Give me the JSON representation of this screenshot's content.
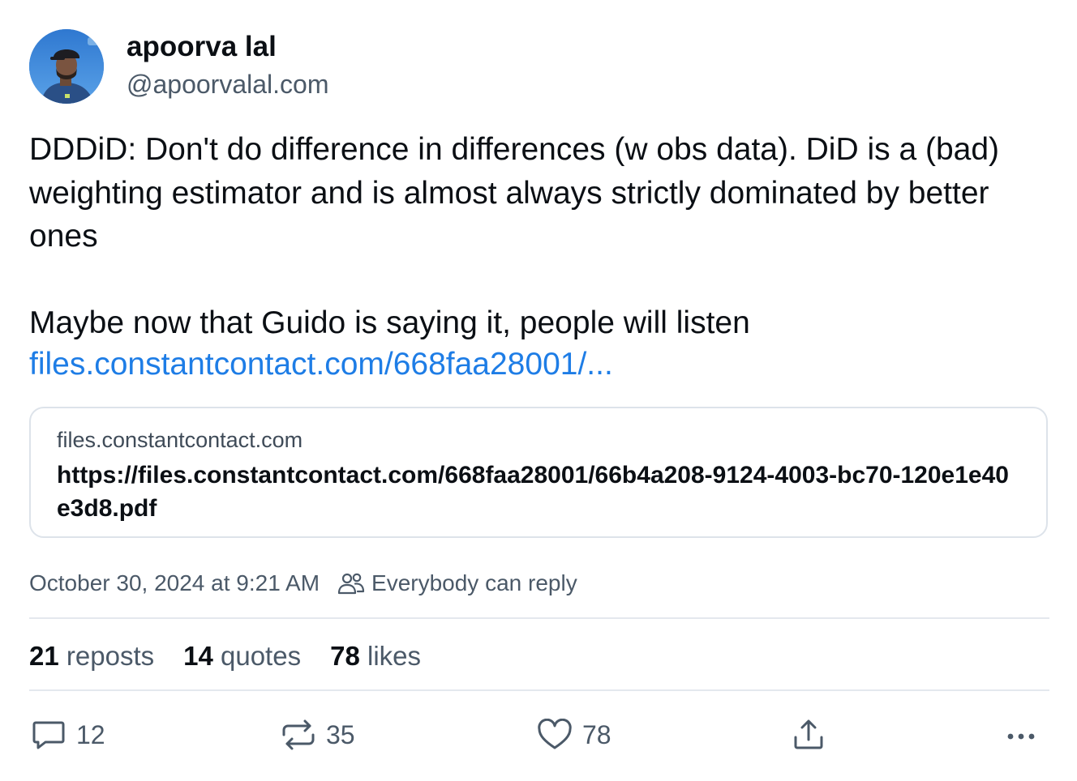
{
  "author": {
    "name": "apoorva lal",
    "handle": "@apoorvalal.com"
  },
  "post": {
    "text": "DDDiD: Don't do difference in differences (w obs data). DiD is a (bad) weighting estimator and is almost always strictly dominated by better ones\n\nMaybe now that Guido is saying it, people will listen",
    "link_text": "files.constantcontact.com/668faa28001/..."
  },
  "embed": {
    "domain": "files.constantcontact.com",
    "title": "https://files.constantcontact.com/668faa28001/66b4a208-9124-4003-bc70-120e1e40e3d8.pdf"
  },
  "meta": {
    "timestamp": "October 30, 2024 at 9:21 AM",
    "reply_setting": "Everybody can reply",
    "reply_icon": "people-icon"
  },
  "stats": {
    "reposts_count": "21",
    "reposts_label": "reposts",
    "quotes_count": "14",
    "quotes_label": "quotes",
    "likes_count": "78",
    "likes_label": "likes"
  },
  "actions": {
    "reply": {
      "icon": "comment-icon",
      "count": "12"
    },
    "repost": {
      "icon": "repost-icon",
      "count": "35"
    },
    "like": {
      "icon": "heart-icon",
      "count": "78"
    },
    "share": {
      "icon": "share-icon"
    },
    "more": {
      "icon": "more-icon"
    }
  },
  "colors": {
    "link": "#1e7de6",
    "muted": "#4b5968",
    "text": "#0b0f14",
    "border": "#dde3ea"
  }
}
